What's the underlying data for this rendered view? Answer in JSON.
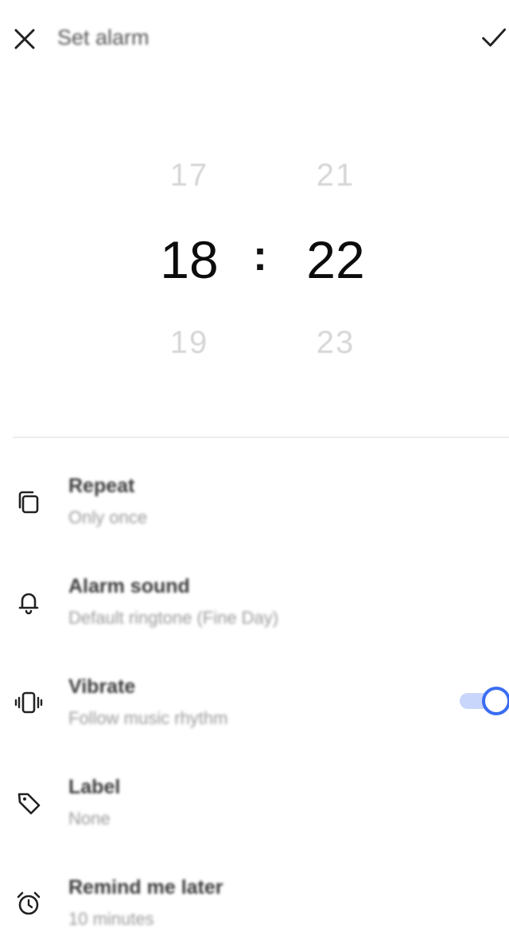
{
  "header": {
    "title": "Set alarm",
    "close_icon": "close-icon",
    "confirm_icon": "check-icon"
  },
  "time_picker": {
    "hours": {
      "previous": "17",
      "current": "18",
      "next": "19"
    },
    "separator": ":",
    "minutes": {
      "previous": "21",
      "current": "22",
      "next": "23"
    }
  },
  "settings": [
    {
      "icon": "repeat-icon",
      "label": "Repeat",
      "value": "Only once"
    },
    {
      "icon": "bell-icon",
      "label": "Alarm sound",
      "value": "Default ringtone (Fine Day)"
    },
    {
      "icon": "vibrate-icon",
      "label": "Vibrate",
      "value": "Follow music rhythm",
      "toggle_on": true
    },
    {
      "icon": "tag-icon",
      "label": "Label",
      "value": "None"
    },
    {
      "icon": "alarm-clock-icon",
      "label": "Remind me later",
      "value": "10 minutes"
    }
  ],
  "colors": {
    "accent": "#3b6df2",
    "toggle_track": "#c9d6fb",
    "faded_number": "#d6d6d6"
  }
}
